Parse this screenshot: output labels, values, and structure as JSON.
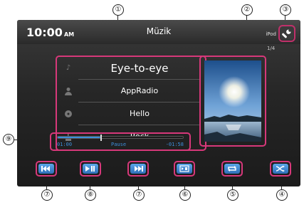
{
  "status_bar": {
    "time": "10:00",
    "ampm": "AM",
    "title": "Müzik",
    "source": "iPod",
    "page_indicator": "1/4"
  },
  "track_info": {
    "song": "Eye-to-eye",
    "artist": "AppRadio",
    "album": "Hello",
    "genre": "Rock",
    "icons": [
      "music-note-icon",
      "person-icon",
      "disc-icon",
      "genre-icon"
    ]
  },
  "progress": {
    "elapsed": "01:00",
    "status": "Pause",
    "remaining": "-01:58",
    "fraction": 0.34
  },
  "controls": [
    {
      "name": "previous-track-button",
      "icon": "skip-back-icon"
    },
    {
      "name": "play-pause-button",
      "icon": "play-pause-icon"
    },
    {
      "name": "next-track-button",
      "icon": "skip-forward-icon"
    },
    {
      "name": "video-mode-button",
      "icon": "video-icon"
    },
    {
      "name": "repeat-button",
      "icon": "repeat-icon"
    },
    {
      "name": "shuffle-button",
      "icon": "shuffle-icon"
    }
  ],
  "callouts": [
    "①",
    "②",
    "③",
    "④",
    "⑤",
    "⑥",
    "⑦",
    "⑧",
    "⑨"
  ],
  "colors": {
    "highlight": "#d7387a",
    "accent": "#3d8fdb",
    "screen_bg": "#262626"
  }
}
